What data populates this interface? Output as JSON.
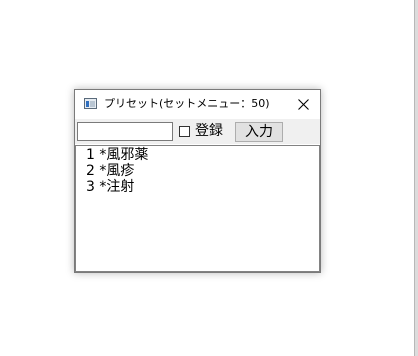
{
  "window": {
    "title": "プリセット(セットメニュー：50)",
    "icon": "app-window-icon",
    "close_icon": "close-icon"
  },
  "toolbar": {
    "input_value": "",
    "checkbox_label": "登録",
    "checkbox_checked": false,
    "submit_label": "入力"
  },
  "list": {
    "items": [
      {
        "label": "1 *風邪薬"
      },
      {
        "label": "2 *風疹"
      },
      {
        "label": "3 *注射"
      }
    ]
  }
}
